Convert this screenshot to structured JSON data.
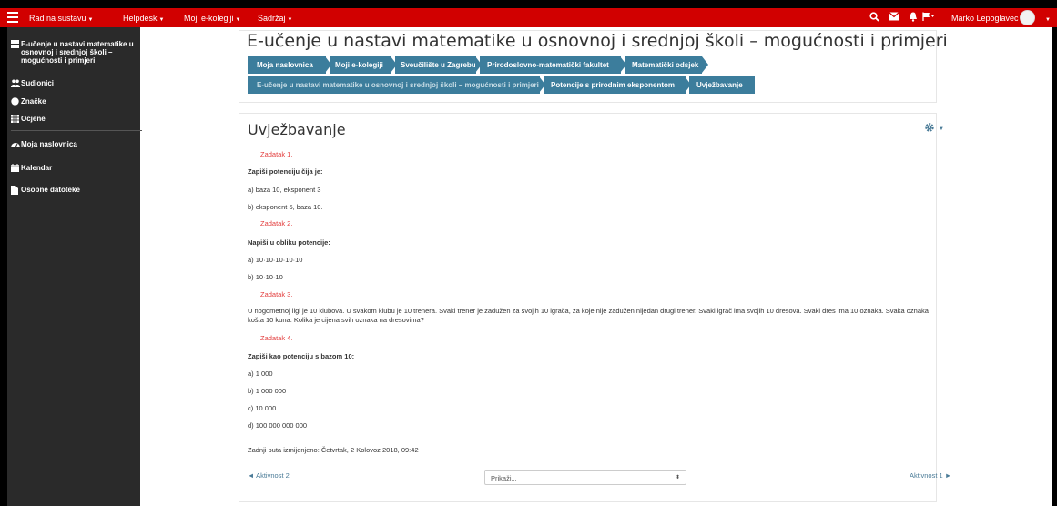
{
  "navbar": {
    "items": [
      {
        "label": "Rad na sustavu"
      },
      {
        "label": "Helpdesk"
      },
      {
        "label": "Moji e-kolegiji"
      },
      {
        "label": "Sadržaj"
      }
    ],
    "user_name": "Marko Lepoglavec",
    "bg_color": "#d10000"
  },
  "sidebar": {
    "course_title": "E-učenje u nastavi matematike u osnovnoj i srednjoj školi – mogućnosti i primjeri",
    "items": [
      {
        "label": "Sudionici",
        "icon": "users-icon"
      },
      {
        "label": "Značke",
        "icon": "badge-icon"
      },
      {
        "label": "Ocjene",
        "icon": "grades-icon"
      },
      {
        "label": "Moja naslovnica",
        "icon": "dashboard-icon"
      },
      {
        "label": "Kalendar",
        "icon": "calendar-icon"
      },
      {
        "label": "Osobne datoteke",
        "icon": "file-icon"
      }
    ]
  },
  "header": {
    "course_title": "E-učenje u nastavi matematike u osnovnoj i srednjoj školi – mogućnosti i primjeri",
    "breadcrumb_row1": [
      "Moja naslovnica",
      "Moji e-kolegiji",
      "Sveučilište u Zagrebu",
      "Prirodoslovno-matematički fakultet",
      "Matematički odsjek"
    ],
    "breadcrumb_row2": [
      "E-učenje u nastavi matematike u osnovnoj i srednjoj školi – mogućnosti i primjeri",
      "Potencije s prirodnim eksponentom",
      "Uvježbavanje"
    ],
    "breadcrumb_color": "#3c7d9c"
  },
  "content": {
    "title": "Uvježbavanje",
    "task1_label": "Zadatak 1.",
    "task1_prompt": "Zapiši potenciju čija je:",
    "task1_a": "a) baza 10, eksponent 3",
    "task1_b": "b) eksponent 5, baza 10.",
    "task2_label": "Zadatak 2.",
    "task2_prompt": "Napiši u obliku potencije:",
    "task2_a": "a) 10·10·10·10·10",
    "task2_b": "b) 10·10·10",
    "task3_label": "Zadatak 3.",
    "task3_text": "U nogometnoj ligi je 10 klubova. U svakom klubu je 10 trenera. Svaki trener je zadužen za svojih 10 igrača, za koje nije zadužen nijedan drugi trener. Svaki igrač ima svojih 10 dresova. Svaki dres ima 10 oznaka. Svaka oznaka košta 10 kuna. Kolika je cijena svih oznaka na dresovima?",
    "task4_label": "Zadatak 4.",
    "task4_prompt": "Zapiši kao potenciju s bazom 10:",
    "task4_a": "a) 1 000",
    "task4_b": "b) 1 000 000",
    "task4_c": "c) 10 000",
    "task4_d": "d) 100 000 000 000",
    "last_modified": "Zadnji puta izmijenjeno: Četvrtak, 2 Kolovoz 2018, 09:42",
    "prev_activity": "◄ Aktivnost 2",
    "next_activity": "Aktivnost 1 ►",
    "jump_placeholder": "Prikaži..."
  }
}
